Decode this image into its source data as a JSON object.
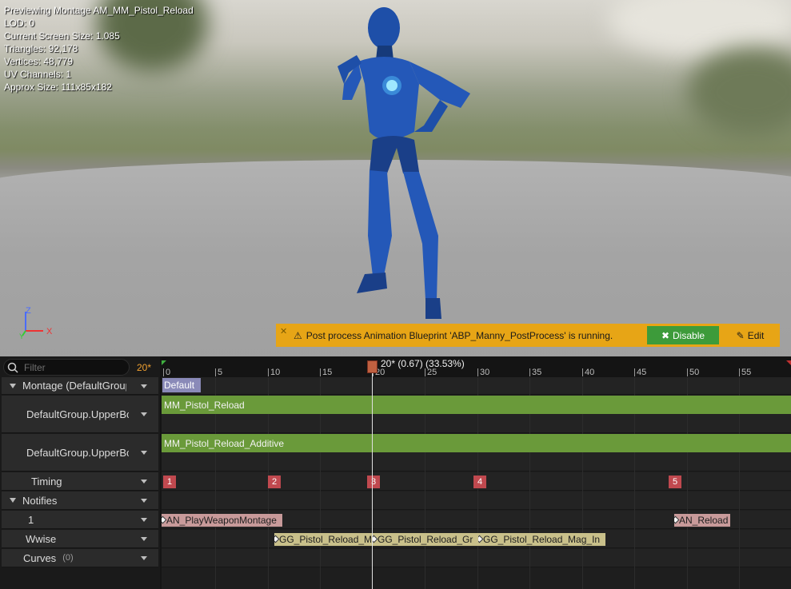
{
  "viewport": {
    "stats": [
      "Previewing Montage AM_MM_Pistol_Reload",
      "LOD: 0",
      "Current Screen Size: 1.085",
      "Triangles: 92,178",
      "Vertices: 48,779",
      "UV Channels: 1",
      "Approx Size: 111x85x182"
    ],
    "axis": {
      "z": "Z",
      "x": "X",
      "y": "Y"
    },
    "warning": {
      "message": "Post process Animation Blueprint 'ABP_Manny_PostProcess' is running.",
      "disable_label": "Disable",
      "edit_label": "Edit",
      "icon": "warning-icon"
    }
  },
  "tracks": {
    "filter_placeholder": "Filter",
    "frame_count": "20*",
    "rows": {
      "montage": "Montage (DefaultGroup",
      "slot1": "DefaultGroup.UpperBc",
      "slot2": "DefaultGroup.UpperBc",
      "timing": "Timing",
      "notifies": "Notifies",
      "notify_track1": "1",
      "wwise": "Wwise",
      "curves": "Curves",
      "curves_count": "(0)"
    }
  },
  "timeline": {
    "playhead_label": "20* (0.67) (33.53%)",
    "ticks": [
      "0",
      "5",
      "10",
      "15",
      "20",
      "25",
      "30",
      "35",
      "40",
      "45",
      "50",
      "55"
    ],
    "section_label": "Default",
    "segments": [
      "MM_Pistol_Reload",
      "MM_Pistol_Reload_Additive"
    ],
    "timing_markers": [
      "1",
      "2",
      "3",
      "4",
      "5"
    ],
    "notifies_track1": [
      "AN_PlayWeaponMontage",
      "AN_Reload"
    ],
    "notifies_wwise": [
      "GG_Pistol_Reload_M",
      "GG_Pistol_Reload_Gr",
      "GG_Pistol_Reload_Mag_In"
    ],
    "colors": {
      "segment": "#6a9a3a",
      "timing": "#c0494f",
      "notify_pink": "#c89a9a",
      "notify_tan": "#c9c08a",
      "warning": "#e7a516",
      "disable": "#3d9b3a"
    }
  }
}
